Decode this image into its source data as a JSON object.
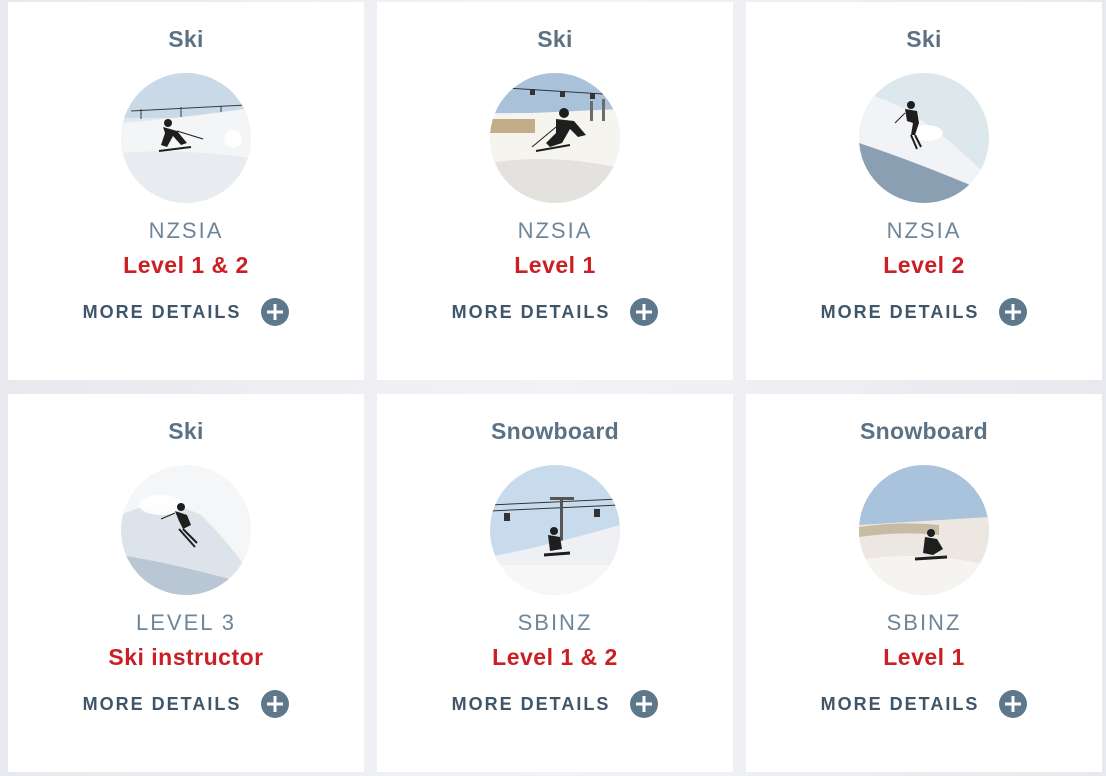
{
  "courses": [
    {
      "sport": "Ski",
      "org": "NZSIA",
      "level": "Level 1 & 2",
      "more": "MORE DETAILS",
      "image": "skier-carving-photo"
    },
    {
      "sport": "Ski",
      "org": "NZSIA",
      "level": "Level 1",
      "more": "MORE DETAILS",
      "image": "skier-chairlift-photo"
    },
    {
      "sport": "Ski",
      "org": "NZSIA",
      "level": "Level 2",
      "more": "MORE DETAILS",
      "image": "skier-steep-slope-photo"
    },
    {
      "sport": "Ski",
      "org": "LEVEL 3",
      "level": "Ski instructor",
      "more": "MORE DETAILS",
      "image": "skier-powder-photo"
    },
    {
      "sport": "Snowboard",
      "org": "SBINZ",
      "level": "Level 1 & 2",
      "more": "MORE DETAILS",
      "image": "snowboarder-chairlift-photo"
    },
    {
      "sport": "Snowboard",
      "org": "SBINZ",
      "level": "Level 1",
      "more": "MORE DETAILS",
      "image": "snowboarder-carving-photo"
    }
  ],
  "icons": {
    "more": "plus-circle-icon"
  },
  "colors": {
    "sport": "#5b7285",
    "org": "#6f8698",
    "level": "#cc1f24",
    "more": "#3f566a",
    "plus": "#5d778b"
  }
}
